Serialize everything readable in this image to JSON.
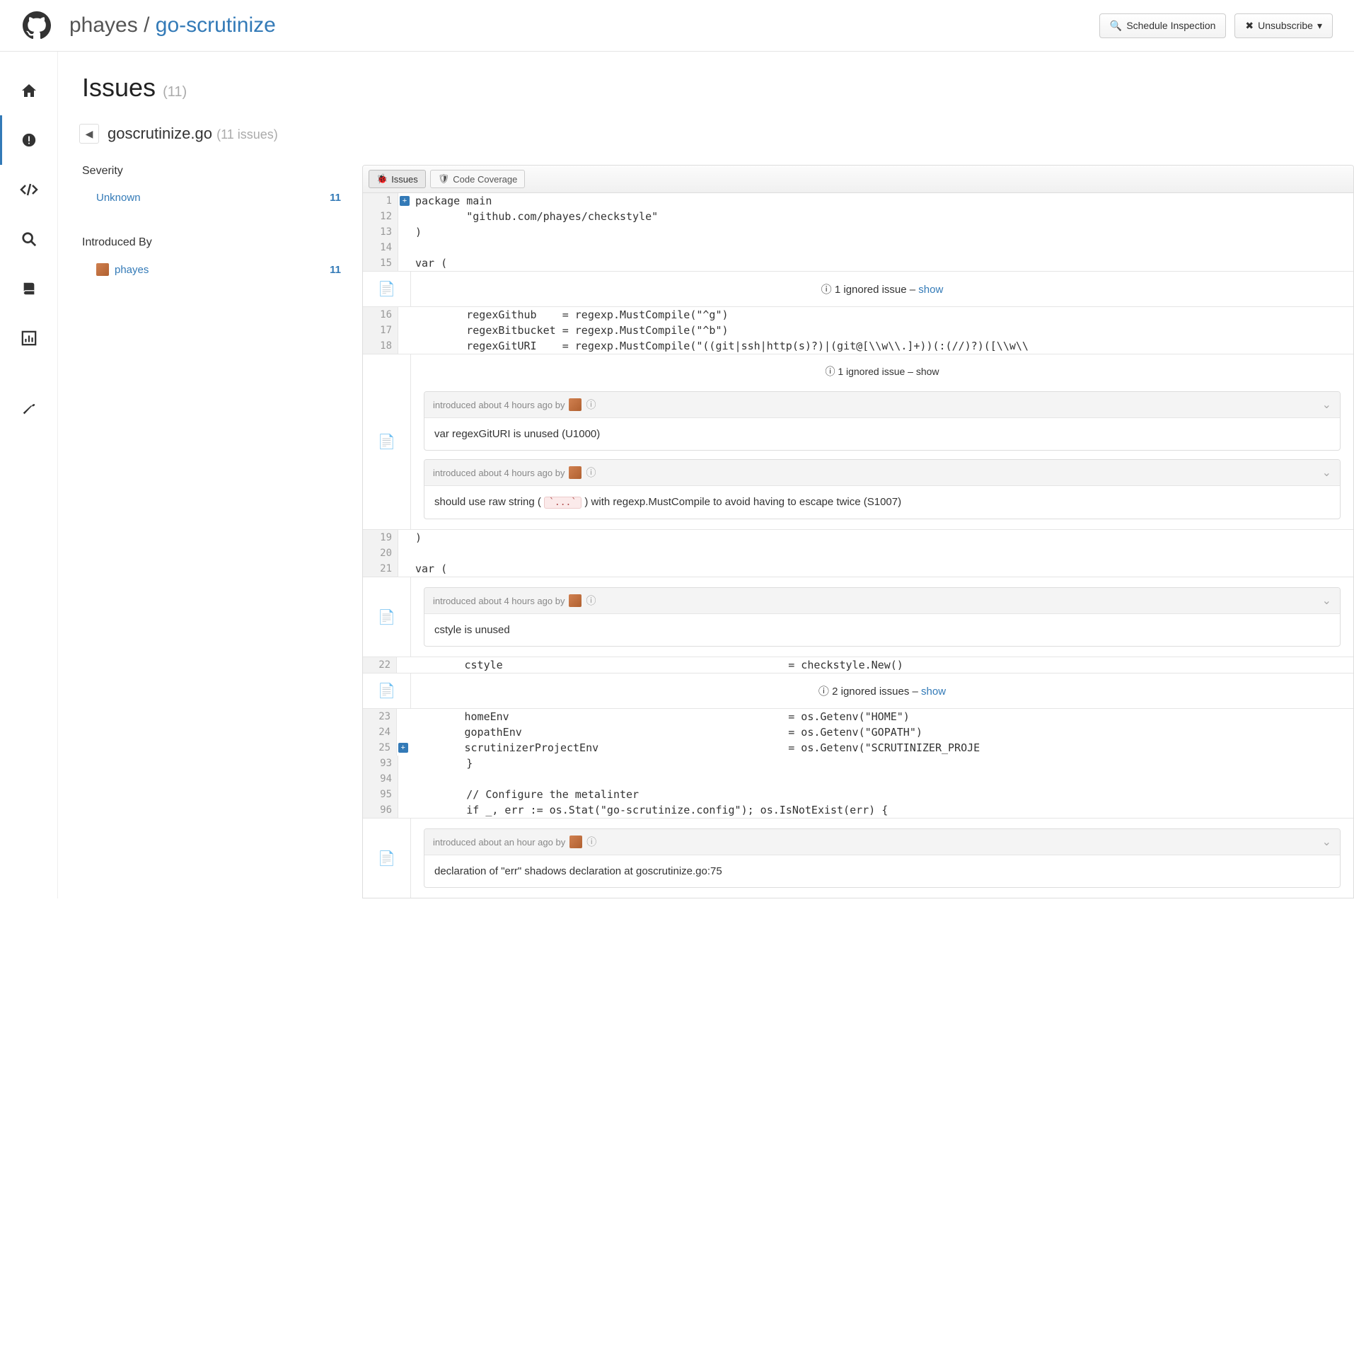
{
  "header": {
    "owner": "phayes",
    "sep": " / ",
    "repo": "go-scrutinize",
    "schedule_label": "Schedule Inspection",
    "unsubscribe_label": "Unsubscribe"
  },
  "page": {
    "title": "Issues",
    "count": "(11)",
    "file": "goscrutinize.go",
    "file_count": "(11 issues)"
  },
  "filters": {
    "severity_title": "Severity",
    "severity_items": [
      {
        "label": "Unknown",
        "count": "11"
      }
    ],
    "introduced_title": "Introduced By",
    "authors": [
      {
        "name": "phayes",
        "count": "11"
      }
    ]
  },
  "tabs": {
    "issues": "Issues",
    "coverage": "Code Coverage"
  },
  "code": {
    "l1": "package main",
    "l12": "        \"github.com/phayes/checkstyle\"",
    "l13": ")",
    "l14": "",
    "l15": "var (",
    "l16": "        regexGithub    = regexp.MustCompile(\"^g\")",
    "l17": "        regexBitbucket = regexp.MustCompile(\"^b\")",
    "l18": "        regexGitURI    = regexp.MustCompile(\"((git|ssh|http(s)?)|(git@[\\\\w\\\\.]+))(:(//)?)([\\\\w\\\\",
    "l19": ")",
    "l20": "",
    "l21": "var (",
    "l22a": "        cstyle",
    "l22b": "= checkstyle.New()",
    "l23a": "        homeEnv",
    "l23b": "= os.Getenv(\"HOME\")",
    "l24a": "        gopathEnv",
    "l24b": "= os.Getenv(\"GOPATH\")",
    "l25a": "        scrutinizerProjectEnv",
    "l25b": "= os.Getenv(\"SCRUTINIZER_PROJE",
    "l93": "        }",
    "l94": "",
    "l95": "        // Configure the metalinter",
    "l96": "        if _, err := os.Stat(\"go-scrutinize.config\"); os.IsNotExist(err) {"
  },
  "issues": {
    "ignored1": "1 ignored issue – ",
    "ignored1b": "1 ignored issue – ",
    "ignored2": "2 ignored issues – ",
    "show": "show",
    "intro4h": "introduced about 4 hours ago by",
    "intro1h": "introduced about an hour ago by",
    "msg_unused_uri": "var regexGitURI is unused (U1000)",
    "msg_raw_pre": "should use raw string (",
    "msg_raw_code": "`...`",
    "msg_raw_post": ") with regexp.MustCompile to avoid having to escape twice (S1007)",
    "msg_cstyle": "cstyle is unused",
    "msg_shadow": "declaration of \"err\" shadows declaration at goscrutinize.go:75"
  },
  "gutters": {
    "g1": "1",
    "g12": "12",
    "g13": "13",
    "g14": "14",
    "g15": "15",
    "g16": "16",
    "g17": "17",
    "g18": "18",
    "g19": "19",
    "g20": "20",
    "g21": "21",
    "g22": "22",
    "g23": "23",
    "g24": "24",
    "g25": "25",
    "g93": "93",
    "g94": "94",
    "g95": "95",
    "g96": "96"
  }
}
